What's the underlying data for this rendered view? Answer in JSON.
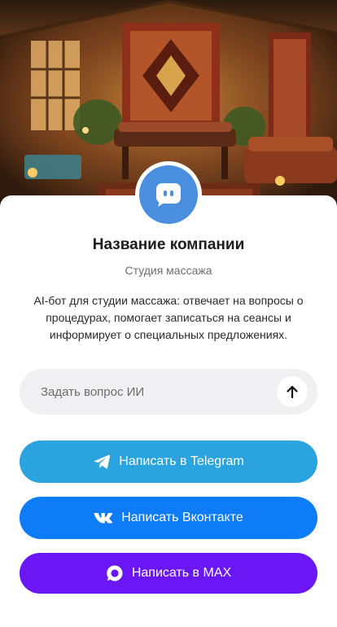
{
  "hero": {
    "image": "massage-studio-interior"
  },
  "profile": {
    "avatar_icon": "chat-bot-icon",
    "avatar_color": "#4a8ee0",
    "company_name": "Название компании",
    "company_type": "Студия массажа",
    "description": "AI-бот для студии массажа: отвечает на вопросы о процедурах, помогает записаться на сеансы и информирует о специальных предложениях."
  },
  "ask": {
    "placeholder": "Задать вопрос ИИ",
    "value": "",
    "send_icon": "arrow-up-icon"
  },
  "buttons": {
    "telegram": {
      "label": "Написать в Telegram",
      "icon": "telegram-icon",
      "color": "#2ba3de"
    },
    "vk": {
      "label": "Написать Вконтакте",
      "icon": "vk-icon",
      "color": "#0e7cf6"
    },
    "max": {
      "label": "Написать в MAX",
      "icon": "max-icon",
      "color": "#6b16f5"
    }
  }
}
